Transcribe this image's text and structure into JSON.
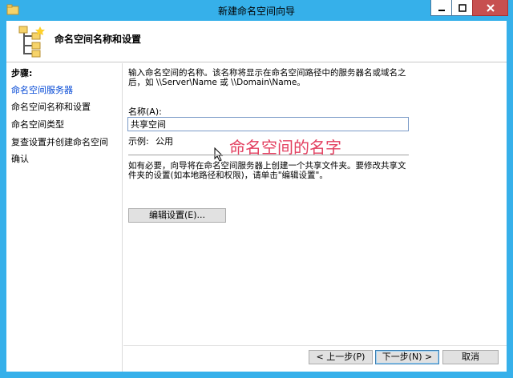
{
  "window": {
    "title": "新建命名空间向导",
    "controls": {
      "minimize": "minimize-icon",
      "maximize": "maximize-icon",
      "close": "close-icon"
    }
  },
  "header": {
    "title": "命名空间名称和设置",
    "icon": "wizard-icon"
  },
  "steps": {
    "label": "步骤:",
    "items": [
      {
        "label": "命名空间服务器",
        "active": true
      },
      {
        "label": "命名空间名称和设置",
        "active": false
      },
      {
        "label": "命名空间类型",
        "active": false
      },
      {
        "label": "复查设置并创建命名空间",
        "active": false
      },
      {
        "label": "确认",
        "active": false
      }
    ]
  },
  "main": {
    "description": "输入命名空间的名称。该名称将显示在命名空间路径中的服务器名或域名之后，如 \\\\Server\\Name 或 \\\\Domain\\Name。",
    "name_label": "名称(A):",
    "name_value": "共享空间",
    "example_label": "示例:",
    "example_value": "公用",
    "annotation": "命名空间的名字",
    "note": "如有必要，向导将在命名空间服务器上创建一个共享文件夹。要修改共享文件夹的设置(如本地路径和权限)，请单击\"编辑设置\"。",
    "edit_button": "编辑设置(E)..."
  },
  "footer": {
    "back": "< 上一步(P)",
    "next": "下一步(N) >",
    "cancel": "取消"
  },
  "colors": {
    "title_bar": "#36b0ea",
    "active_step": "#0046d5",
    "annotation": "#e34060",
    "close_button": "#c75050"
  }
}
